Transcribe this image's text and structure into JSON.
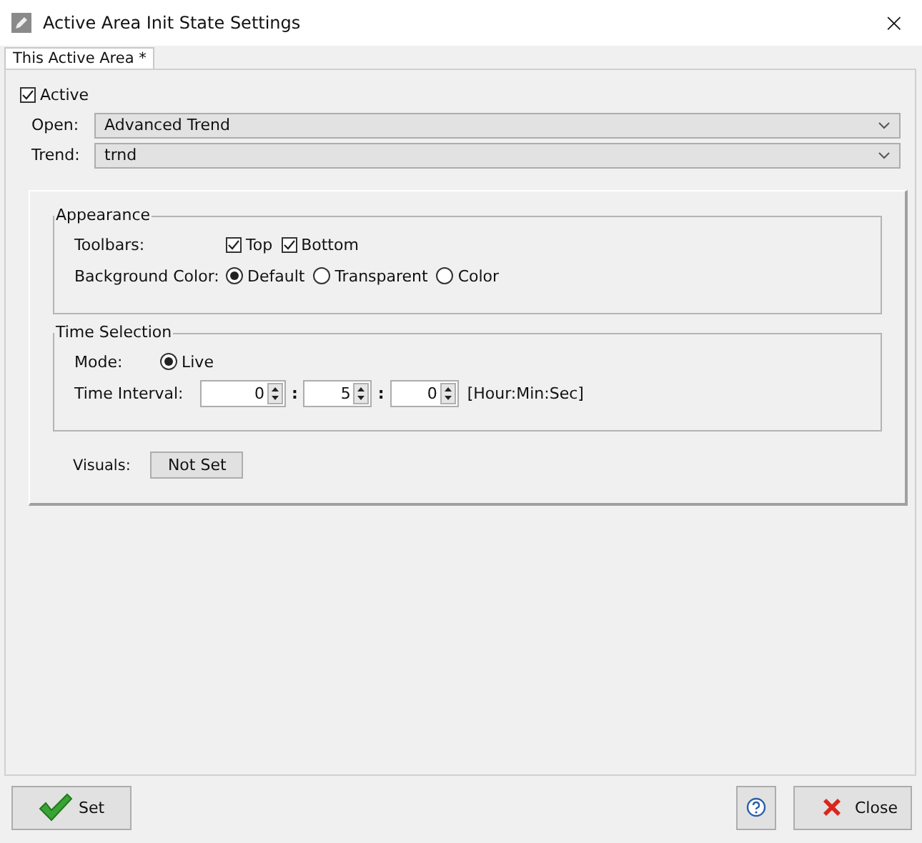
{
  "window": {
    "title": "Active Area Init State Settings",
    "close": "×"
  },
  "tabs": [
    {
      "label": "This Active Area *",
      "selected": true
    }
  ],
  "active": {
    "label": "Active",
    "checked": true
  },
  "fields": [
    {
      "label": "Open:",
      "value": "Advanced Trend"
    },
    {
      "label": "Trend:",
      "value": "trnd"
    }
  ],
  "appearance": {
    "title": "Appearance",
    "toolbars": {
      "label": "Toolbars:",
      "options": [
        {
          "label": "Top",
          "checked": true
        },
        {
          "label": "Bottom",
          "checked": true
        }
      ]
    },
    "background": {
      "label": "Background Color:",
      "options": [
        {
          "label": "Default",
          "selected": true
        },
        {
          "label": "Transparent",
          "selected": false
        },
        {
          "label": "Color",
          "selected": false
        }
      ]
    }
  },
  "time_selection": {
    "title": "Time Selection",
    "mode": {
      "label": "Mode:",
      "options": [
        {
          "label": "Live",
          "selected": true
        }
      ]
    },
    "interval": {
      "label": "Time Interval:",
      "parts": [
        "0",
        "5",
        "0"
      ],
      "separators": [
        ":",
        ":"
      ],
      "unit": "[Hour:Min:Sec]"
    }
  },
  "visuals": {
    "label": "Visuals:",
    "button": "Not Set"
  },
  "buttons": {
    "set": "Set",
    "close": "Close"
  }
}
